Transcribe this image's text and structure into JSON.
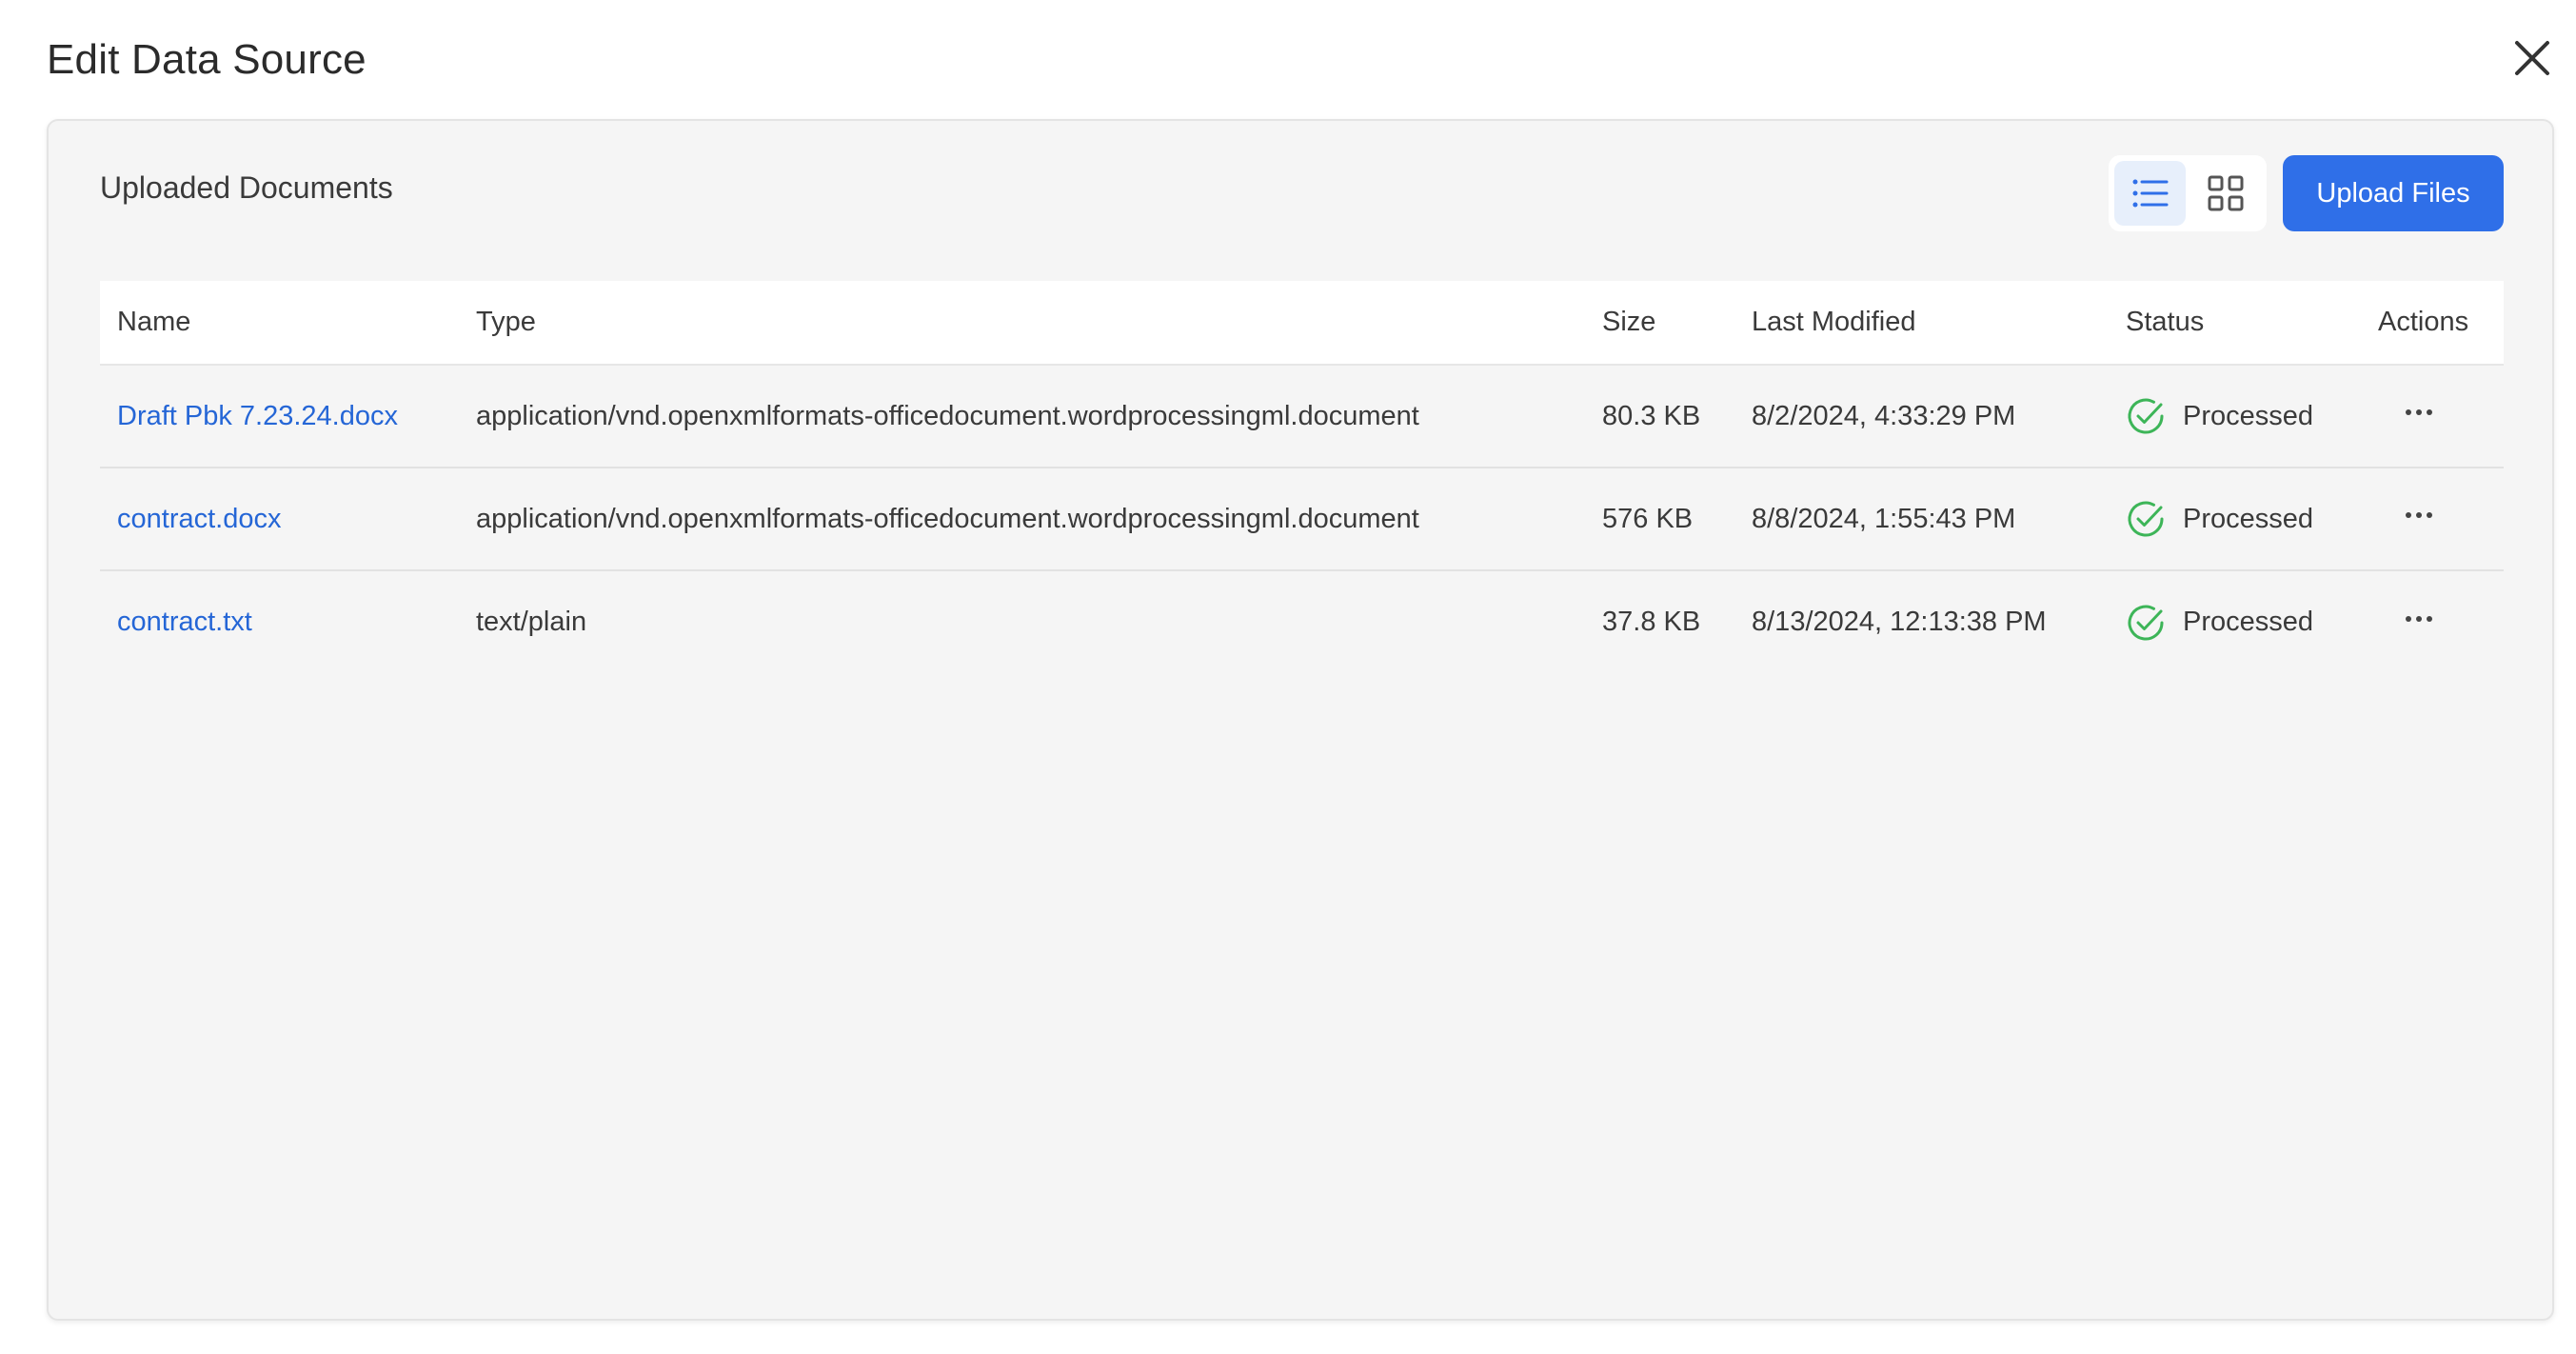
{
  "dialog": {
    "title": "Edit Data Source"
  },
  "panel": {
    "heading": "Uploaded Documents",
    "upload_label": "Upload Files",
    "view_mode": "list"
  },
  "table": {
    "columns": [
      "Name",
      "Type",
      "Size",
      "Last Modified",
      "Status",
      "Actions"
    ],
    "rows": [
      {
        "name": "Draft Pbk 7.23.24.docx",
        "type": "application/vnd.openxmlformats-officedocument.wordprocessingml.document",
        "size": "80.3 KB",
        "modified": "8/2/2024, 4:33:29 PM",
        "status": "Processed"
      },
      {
        "name": "contract.docx",
        "type": "application/vnd.openxmlformats-officedocument.wordprocessingml.document",
        "size": "576 KB",
        "modified": "8/8/2024, 1:55:43 PM",
        "status": "Processed"
      },
      {
        "name": "contract.txt",
        "type": "text/plain",
        "size": "37.8 KB",
        "modified": "8/13/2024, 12:13:38 PM",
        "status": "Processed"
      }
    ]
  },
  "colors": {
    "accent": "#2f6fe8",
    "link": "#2566d6",
    "success": "#3db558",
    "icon_active": "#2f6fe8",
    "icon_inactive": "#555555"
  },
  "icons": {
    "close": "close-icon",
    "list_view": "list-view-icon",
    "grid_view": "grid-view-icon",
    "status": "check-circle-icon",
    "actions": "more-horizontal-icon"
  }
}
